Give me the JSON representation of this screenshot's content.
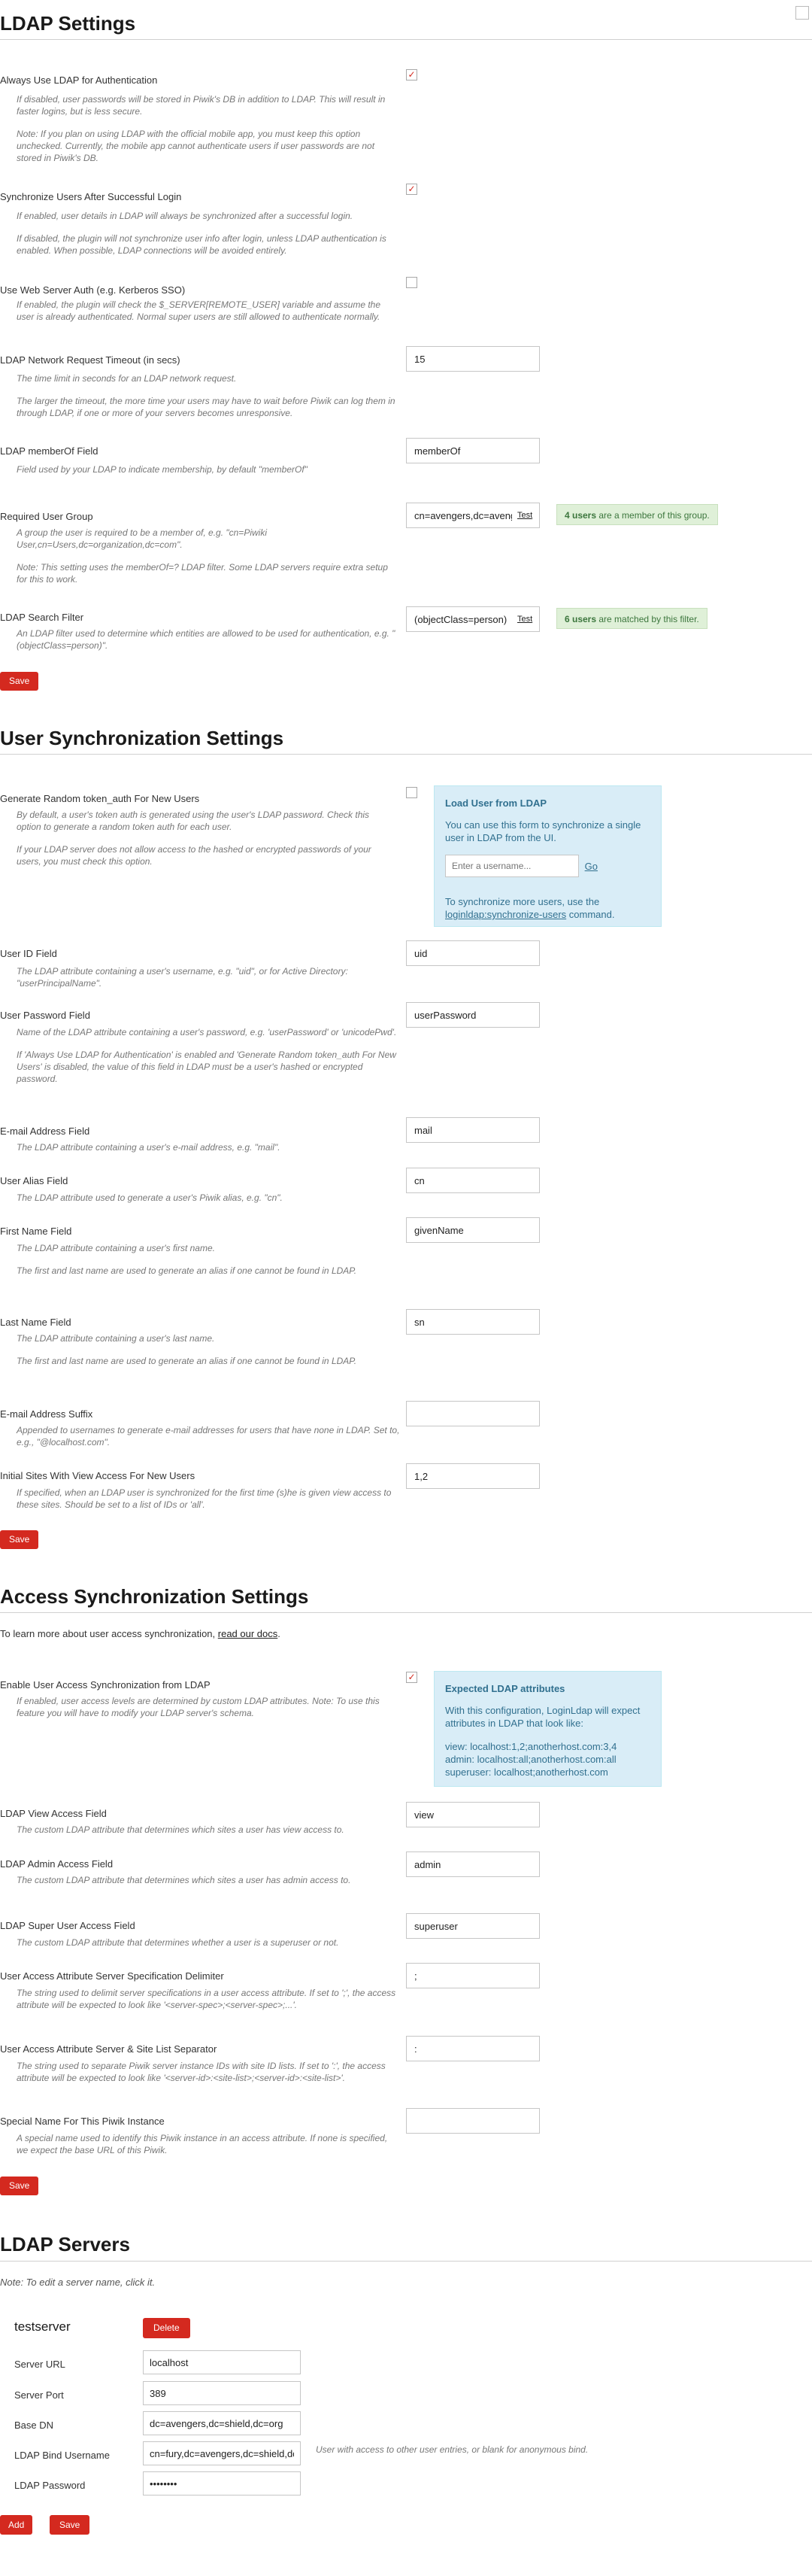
{
  "corner": {
    "icon": "square-icon"
  },
  "ldap_settings": {
    "title": "LDAP Settings",
    "always_use": {
      "label": "Always Use LDAP for Authentication",
      "checked": true,
      "help1": "If disabled, user passwords will be stored in Piwik's DB in addition to LDAP. This will result in faster logins, but is less secure.",
      "help2": "Note: If you plan on using LDAP with the official mobile app, you must keep this option unchecked. Currently, the mobile app cannot authenticate users if user passwords are not stored in Piwik's DB."
    },
    "sync_users": {
      "label": "Synchronize Users After Successful Login",
      "checked": true,
      "help1": "If enabled, user details in LDAP will always be synchronized after a successful login.",
      "help2": "If disabled, the plugin will not synchronize user info after login, unless LDAP authentication is enabled. When possible, LDAP connections will be avoided entirely."
    },
    "web_server_auth": {
      "label": "Use Web Server Auth (e.g. Kerberos SSO)",
      "checked": false,
      "help1": "If enabled, the plugin will check the $_SERVER[REMOTE_USER] variable and assume the user is already authenticated. Normal super users are still allowed to authenticate normally."
    },
    "timeout": {
      "label": "LDAP Network Request Timeout (in secs)",
      "value": "15",
      "help1": "The time limit in seconds for an LDAP network request.",
      "help2": "The larger the timeout, the more time your users may have to wait before Piwik can log them in through LDAP, if one or more of your servers becomes unresponsive."
    },
    "member_of": {
      "label": "LDAP memberOf Field",
      "value": "memberOf",
      "help1": "Field used by your LDAP to indicate membership, by default \"memberOf\""
    },
    "required_group": {
      "label": "Required User Group",
      "value": "cn=avengers,dc=avengers,dc=shield,dc=org",
      "test": "Test",
      "badge_count": "4 users",
      "badge_text": " are a member of this group.",
      "help1": "A group the user is required to be a member of, e.g. \"cn=Piwiki User,cn=Users,dc=organization,dc=com\".",
      "help2": "Note: This setting uses the memberOf=? LDAP filter. Some LDAP servers require extra setup for this to work."
    },
    "search_filter": {
      "label": "LDAP Search Filter",
      "value": "(objectClass=person)",
      "test": "Test",
      "badge_count": "6 users",
      "badge_text": " are matched by this filter.",
      "help1": "An LDAP filter used to determine which entities are allowed to be used for authentication, e.g. \"(objectClass=person)\"."
    },
    "save": "Save"
  },
  "user_sync": {
    "title": "User Synchronization Settings",
    "random_token": {
      "label": "Generate Random token_auth For New Users",
      "checked": false,
      "help1": "By default, a user's token auth is generated using the user's LDAP password. Check this option to generate a random token auth for each user.",
      "help2": "If your LDAP server does not allow access to the hashed or encrypted passwords of your users, you must check this option."
    },
    "load_box": {
      "title": "Load User from LDAP",
      "text": "You can use this form to synchronize a single user in LDAP from the UI.",
      "placeholder": "Enter a username...",
      "go": "Go",
      "text2": "To synchronize more users, use the",
      "command": "loginldap:synchronize-users",
      "text3": " command."
    },
    "uid": {
      "label": "User ID Field",
      "value": "uid",
      "help1": "The LDAP attribute containing a user's username, e.g. \"uid\", or for Active Directory: \"userPrincipalName\"."
    },
    "password": {
      "label": "User Password Field",
      "value": "userPassword",
      "help1": "Name of the LDAP attribute containing a user's password, e.g. 'userPassword' or 'unicodePwd'.",
      "help2": "If 'Always Use LDAP for Authentication' is enabled and 'Generate Random token_auth For New Users' is disabled, the value of this field in LDAP must be a user's hashed or encrypted password."
    },
    "email": {
      "label": "E-mail Address Field",
      "value": "mail",
      "help1": "The LDAP attribute containing a user's e-mail address, e.g. \"mail\"."
    },
    "alias": {
      "label": "User Alias Field",
      "value": "cn",
      "help1": "The LDAP attribute used to generate a user's Piwik alias, e.g. \"cn\"."
    },
    "first_name": {
      "label": "First Name Field",
      "value": "givenName",
      "help1": "The LDAP attribute containing a user's first name.",
      "help2": "The first and last name are used to generate an alias if one cannot be found in LDAP."
    },
    "last_name": {
      "label": "Last Name Field",
      "value": "sn",
      "help1": "The LDAP attribute containing a user's last name.",
      "help2": "The first and last name are used to generate an alias if one cannot be found in LDAP."
    },
    "email_suffix": {
      "label": "E-mail Address Suffix",
      "value": "",
      "help1": "Appended to usernames to generate e-mail addresses for users that have none in LDAP. Set to, e.g., \"@localhost.com\"."
    },
    "initial_sites": {
      "label": "Initial Sites With View Access For New Users",
      "value": "1,2",
      "help1": "If specified, when an LDAP user is synchronized for the first time (s)he is given view access to these sites. Should be set to a list of IDs or 'all'."
    },
    "save": "Save"
  },
  "access_sync": {
    "title": "Access Synchronization Settings",
    "intro": "To learn more about user access synchronization, ",
    "intro_link": "read our docs",
    "intro_end": ".",
    "enable": {
      "label": "Enable User Access Synchronization from LDAP",
      "checked": true,
      "help1": "If enabled, user access levels are determined by custom LDAP attributes. Note: To use this feature you will have to modify your LDAP server's schema."
    },
    "expected_box": {
      "title": "Expected LDAP attributes",
      "text": "With this configuration, LoginLdap will expect attributes in LDAP that look like:",
      "lines": [
        "view: localhost:1,2;anotherhost.com:3,4",
        "admin: localhost:all;anotherhost.com:all",
        "superuser: localhost;anotherhost.com"
      ]
    },
    "view_field": {
      "label": "LDAP View Access Field",
      "value": "view",
      "help1": "The custom LDAP attribute that determines which sites a user has view access to."
    },
    "admin_field": {
      "label": "LDAP Admin Access Field",
      "value": "admin",
      "help1": "The custom LDAP attribute that determines which sites a user has admin access to."
    },
    "superuser_field": {
      "label": "LDAP Super User Access Field",
      "value": "superuser",
      "help1": "The custom LDAP attribute that determines whether a user is a superuser or not."
    },
    "server_delim": {
      "label": "User Access Attribute Server Specification Delimiter",
      "value": ";",
      "help1": "The string used to delimit server specifications in a user access attribute. If set to ';', the access attribute will be expected to look like '<server-spec>;<server-spec>;...'."
    },
    "site_sep": {
      "label": "User Access Attribute Server & Site List Separator",
      "value": ":",
      "help1": "The string used to separate Piwik server instance IDs with site ID lists. If set to ':', the access attribute will be expected to look like '<server-id>:<site-list>;<server-id>:<site-list>'."
    },
    "special_name": {
      "label": "Special Name For This Piwik Instance",
      "value": "",
      "help1": "A special name used to identify this Piwik instance in an access attribute. If none is specified, we expect the base URL of this Piwik."
    },
    "save": "Save"
  },
  "servers": {
    "title": "LDAP Servers",
    "note": "Note: To edit a server name, click it.",
    "server_name": "testserver",
    "delete": "Delete",
    "url_label": "Server URL",
    "url_value": "localhost",
    "port_label": "Server Port",
    "port_value": "389",
    "base_dn_label": "Base DN",
    "base_dn_value": "dc=avengers,dc=shield,dc=org",
    "bind_label": "LDAP Bind Username",
    "bind_value": "cn=fury,dc=avengers,dc=shield,dc=org",
    "bind_help": "User with access to other user entries, or blank for anonymous bind.",
    "pw_label": "LDAP Password",
    "pw_value": "••••••••",
    "add": "Add",
    "save": "Save"
  }
}
